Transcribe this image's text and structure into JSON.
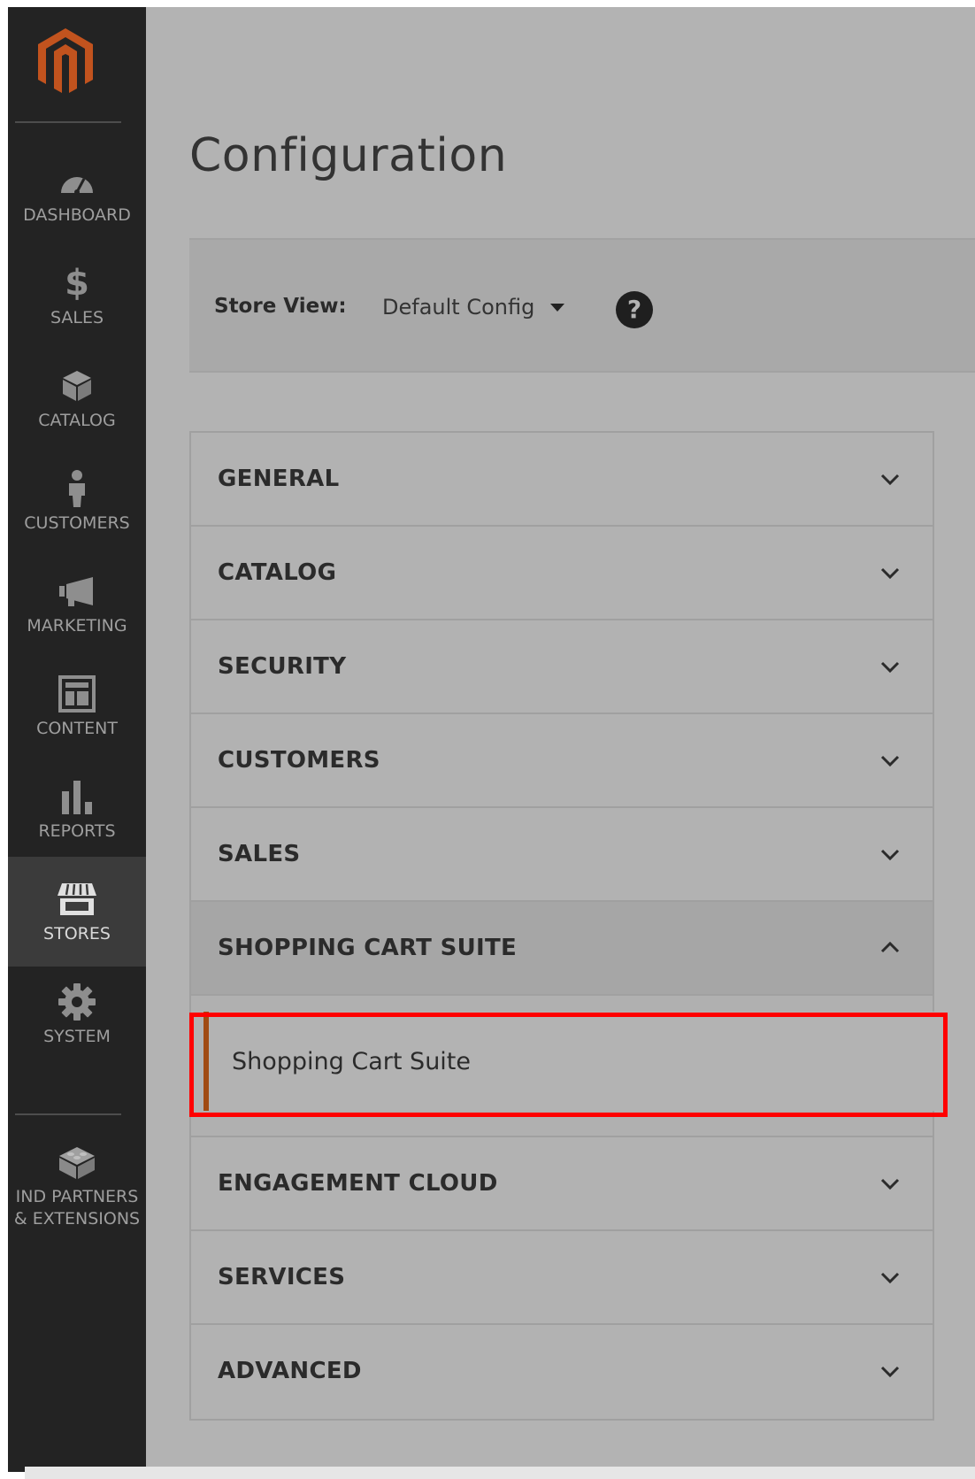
{
  "page": {
    "title": "Configuration"
  },
  "sidebar": {
    "items": [
      {
        "label": "DASHBOARD",
        "icon": "dashboard-icon"
      },
      {
        "label": "SALES",
        "icon": "dollar-icon"
      },
      {
        "label": "CATALOG",
        "icon": "box-icon"
      },
      {
        "label": "CUSTOMERS",
        "icon": "person-icon"
      },
      {
        "label": "MARKETING",
        "icon": "megaphone-icon"
      },
      {
        "label": "CONTENT",
        "icon": "layout-icon"
      },
      {
        "label": "REPORTS",
        "icon": "bar-chart-icon"
      },
      {
        "label": "STORES",
        "icon": "storefront-icon",
        "active": true
      },
      {
        "label": "SYSTEM",
        "icon": "gear-icon"
      },
      {
        "label": "IND PARTNERS\n& EXTENSIONS",
        "icon": "blocks-icon"
      }
    ]
  },
  "store_view": {
    "label": "Store View:",
    "value": "Default Config",
    "help": "?"
  },
  "sections": [
    {
      "title": "GENERAL"
    },
    {
      "title": "CATALOG"
    },
    {
      "title": "SECURITY"
    },
    {
      "title": "CUSTOMERS"
    },
    {
      "title": "SALES"
    },
    {
      "title": "SHOPPING CART SUITE",
      "open": true,
      "items": [
        "Shopping Cart Suite"
      ]
    },
    {
      "title": "ENGAGEMENT CLOUD"
    },
    {
      "title": "SERVICES"
    },
    {
      "title": "ADVANCED"
    }
  ],
  "colors": {
    "accent": "#a04a12",
    "highlight": "#ff0000",
    "logo": "#c2531e"
  }
}
